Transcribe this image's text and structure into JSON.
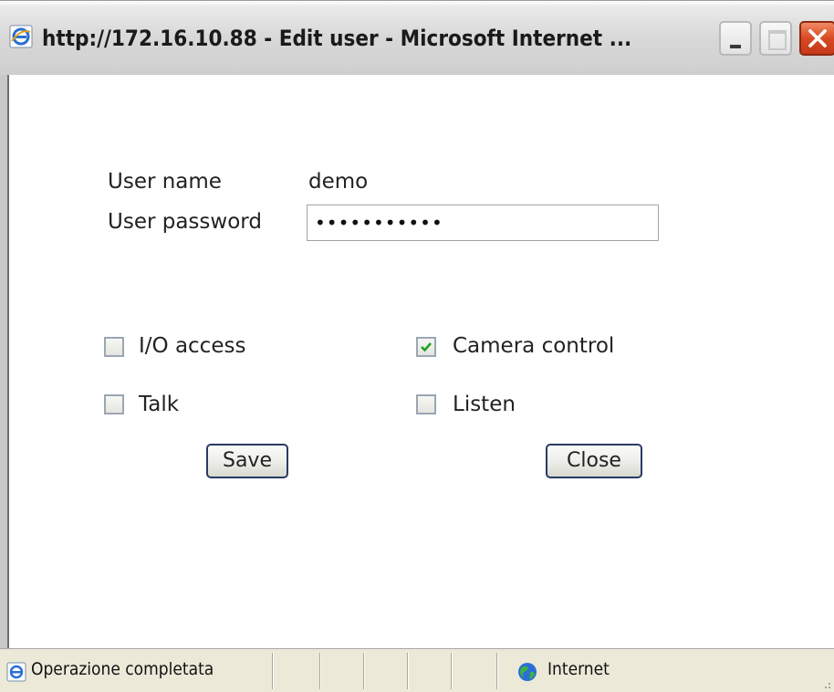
{
  "window": {
    "title": "http://172.16.10.88 - Edit user - Microsoft Internet ..."
  },
  "form": {
    "user_name_label": "User name",
    "user_name_value": "demo",
    "user_password_label": "User password",
    "user_password_value": "•••••••••••",
    "options": [
      {
        "label": "I/O access",
        "checked": false
      },
      {
        "label": "Camera control",
        "checked": true
      },
      {
        "label": "Talk",
        "checked": false
      },
      {
        "label": "Listen",
        "checked": false
      }
    ],
    "save_label": "Save",
    "close_label": "Close"
  },
  "status_bar": {
    "status_text": "Operazione completata",
    "zone_text": "Internet"
  },
  "colors": {
    "check_mark": "#21a121",
    "close_button": "#d84a22"
  }
}
